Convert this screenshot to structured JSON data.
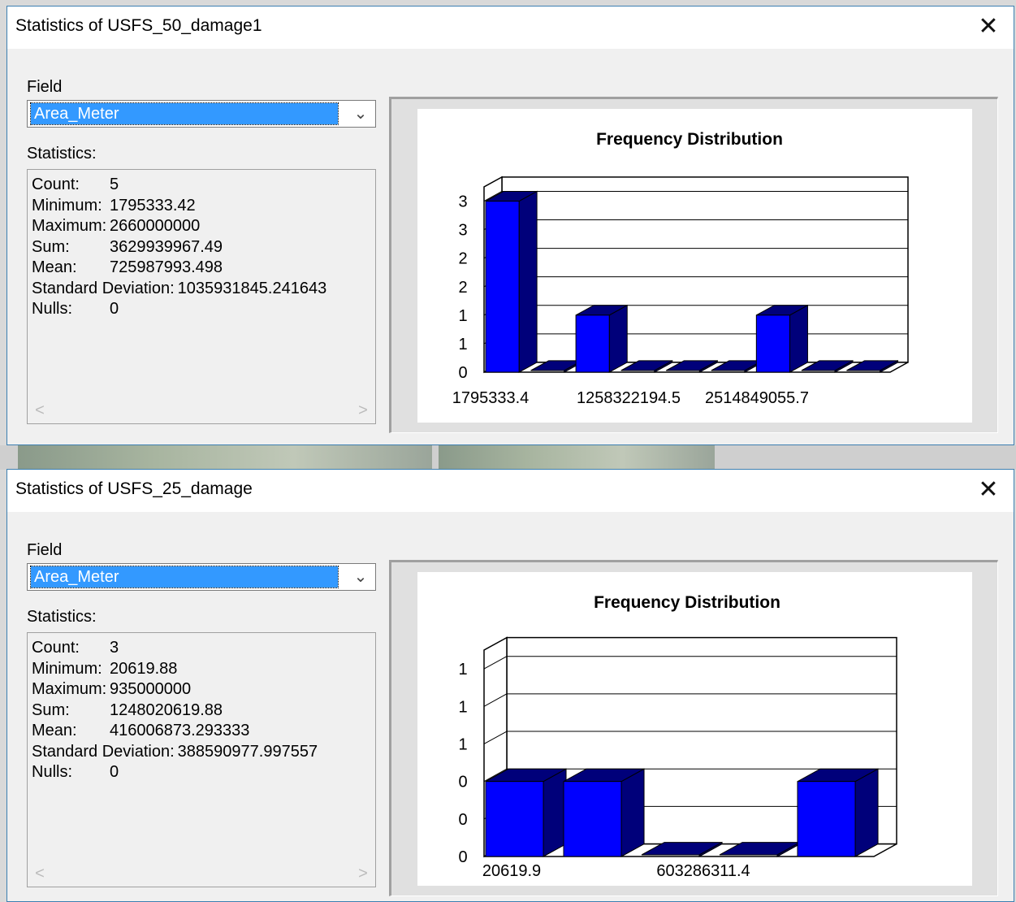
{
  "dialogs": [
    {
      "title": "Statistics of USFS_50_damage1",
      "field_label": "Field",
      "field_value": "Area_Meter",
      "statistics_label": "Statistics:",
      "stats": [
        {
          "key": "Count:",
          "value": "5"
        },
        {
          "key": "Minimum:",
          "value": "1795333.42"
        },
        {
          "key": "Maximum:",
          "value": "2660000000"
        },
        {
          "key": "Sum:",
          "value": "3629939967.49"
        },
        {
          "key": "Mean:",
          "value": "725987993.498"
        },
        {
          "key": "Standard Deviation:",
          "value": "1035931845.241643"
        },
        {
          "key": "Nulls:",
          "value": "0"
        }
      ],
      "chart_data": {
        "type": "bar",
        "title": "Frequency Distribution",
        "values": [
          3,
          0,
          1,
          0,
          0,
          0,
          1,
          0,
          0
        ],
        "y_tick_labels": [
          "0",
          "1",
          "1",
          "2",
          "2",
          "3",
          "3"
        ],
        "x_tick_labels": [
          "1795333.4",
          "1258322194.5",
          "2514849055.7"
        ],
        "ylim": [
          0,
          3.25
        ],
        "grid": true,
        "bar_color": "#0000ff",
        "bar_side_color": "#00007a"
      }
    },
    {
      "title": "Statistics of USFS_25_damage",
      "field_label": "Field",
      "field_value": "Area_Meter",
      "statistics_label": "Statistics:",
      "stats": [
        {
          "key": "Count:",
          "value": "3"
        },
        {
          "key": "Minimum:",
          "value": "20619.88"
        },
        {
          "key": "Maximum:",
          "value": "935000000"
        },
        {
          "key": "Sum:",
          "value": "1248020619.88"
        },
        {
          "key": "Mean:",
          "value": "416006873.293333"
        },
        {
          "key": "Standard Deviation:",
          "value": "388590977.997557"
        },
        {
          "key": "Nulls:",
          "value": "0"
        }
      ],
      "chart_data": {
        "type": "bar",
        "title": "Frequency Distribution",
        "values": [
          1,
          1,
          0,
          0,
          1
        ],
        "y_tick_labels": [
          "0",
          "0",
          "0",
          "1",
          "1",
          "1"
        ],
        "x_tick_labels": [
          "20619.9",
          "603286311.4"
        ],
        "ylim": [
          0,
          1.25
        ],
        "grid": true,
        "bar_color": "#0000ff",
        "bar_side_color": "#00007a"
      }
    }
  ],
  "close_icon": "close-icon",
  "dropdown_icon": "chevron-down-icon"
}
